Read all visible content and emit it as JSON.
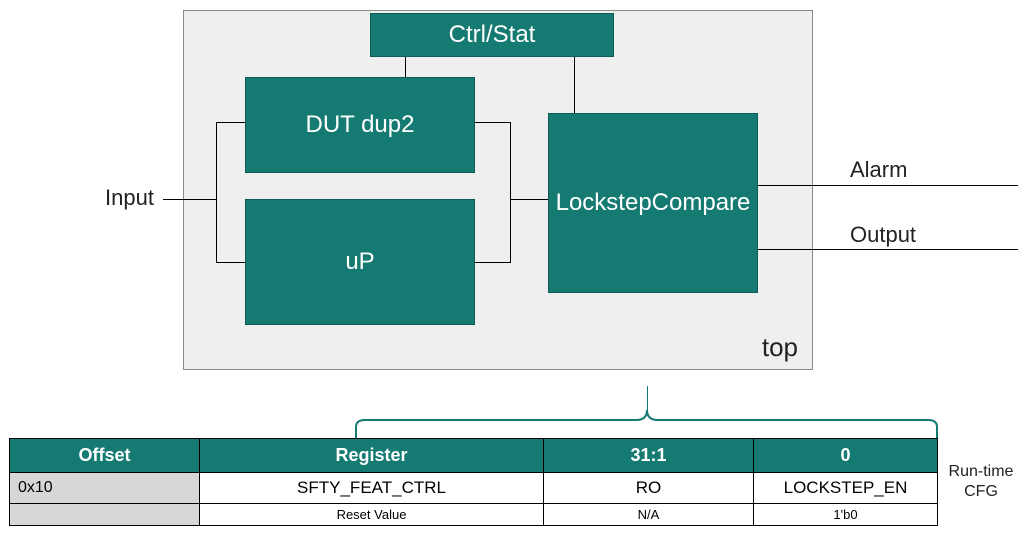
{
  "colors": {
    "teal": "#157a72",
    "panel": "#efefef"
  },
  "diagram": {
    "module_label": "top",
    "blocks": {
      "ctrlstat": "Ctrl/Stat",
      "dutdup2": "DUT dup2",
      "up": "uP",
      "lockstep_l1": "Lockstep",
      "lockstep_l2": "Compare"
    },
    "ports": {
      "input": "Input",
      "alarm": "Alarm",
      "output": "Output"
    }
  },
  "table": {
    "headers": {
      "offset": "Offset",
      "register": "Register",
      "bits_hi": "31:1",
      "bits_lo": "0"
    },
    "row": {
      "offset": "0x10",
      "register": "SFTY_FEAT_CTRL",
      "bits_hi": "RO",
      "bits_lo": "LOCKSTEP_EN"
    },
    "reset": {
      "label": "Reset Value",
      "bits_hi": "N/A",
      "bits_lo": "1'b0"
    },
    "side_label_l1": "Run-time",
    "side_label_l2": "CFG"
  }
}
